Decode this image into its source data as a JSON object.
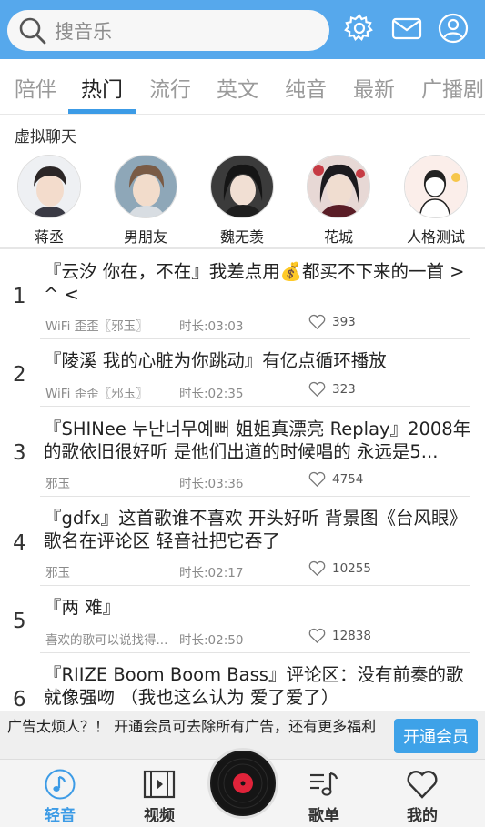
{
  "header": {
    "search_placeholder": "搜音乐",
    "icons": [
      "search-icon",
      "gear-icon",
      "mail-icon",
      "user-icon"
    ],
    "bg_color": "#56a8ec"
  },
  "tabs": [
    {
      "label": "陪伴",
      "active": false
    },
    {
      "label": "热门",
      "active": true
    },
    {
      "label": "流行",
      "active": false
    },
    {
      "label": "英文",
      "active": false
    },
    {
      "label": "纯音",
      "active": false
    },
    {
      "label": "最新",
      "active": false
    },
    {
      "label": "广播剧",
      "active": false
    }
  ],
  "virtual_chat": {
    "title": "虚拟聊天",
    "characters": [
      {
        "name": "蒋丞"
      },
      {
        "name": "男朋友"
      },
      {
        "name": "魏无羡"
      },
      {
        "name": "花城"
      },
      {
        "name": "人格测试"
      }
    ]
  },
  "songs": [
    {
      "rank": "1",
      "title": "『云汐   你在，不在』我差点用💰都买不下来的一首 > ^ < ",
      "author": "WiFi 歪歪〖邪玉〗",
      "duration": "时长:03:03",
      "likes": "393"
    },
    {
      "rank": "2",
      "title": "『陵溪 我的心脏为你跳动』有亿点循环播放",
      "author": "WiFi 歪歪〖邪玉〗",
      "duration": "时长:02:35",
      "likes": "323"
    },
    {
      "rank": "3",
      "title": "『SHINee     누난너무예뻐 姐姐真漂亮 Replay』2008年的歌依旧很好听 是他们出道的时候唱的 永远是5...",
      "author": "邪玉",
      "duration": "时长:03:36",
      "likes": "4754"
    },
    {
      "rank": "4",
      "title": "『gdfx』这首歌谁不喜欢 开头好听 背景图《台风眼》歌名在评论区 轻音社把它吞了",
      "author": "邪玉",
      "duration": "时长:02:17",
      "likes": "10255"
    },
    {
      "rank": "5",
      "title": "『两 难』",
      "author": "喜欢的歌可以说找得...",
      "duration": "时长:02:50",
      "likes": "12838"
    },
    {
      "rank": "6",
      "title": "『RIIZE    Boom Boom Bass』评论区：没有前奏的歌就像强吻 （我也这么认为 爱了爱了）",
      "author": "",
      "duration": "",
      "likes": ""
    }
  ],
  "ad": {
    "text": "广告太烦人？！ 开通会员可去除所有广告，还有更多福利",
    "button": "开通会员"
  },
  "nav": [
    {
      "label": "轻音",
      "icon": "music-note-icon",
      "active": true
    },
    {
      "label": "视频",
      "icon": "video-icon",
      "active": false
    },
    {
      "label": "",
      "icon": "vinyl-disc-icon",
      "active": false
    },
    {
      "label": "歌单",
      "icon": "playlist-icon",
      "active": false
    },
    {
      "label": "我的",
      "icon": "heart-icon",
      "active": false
    }
  ],
  "colors": {
    "accent": "#3c9be6",
    "header": "#56a8ec",
    "disc_center": "#e0233a"
  }
}
